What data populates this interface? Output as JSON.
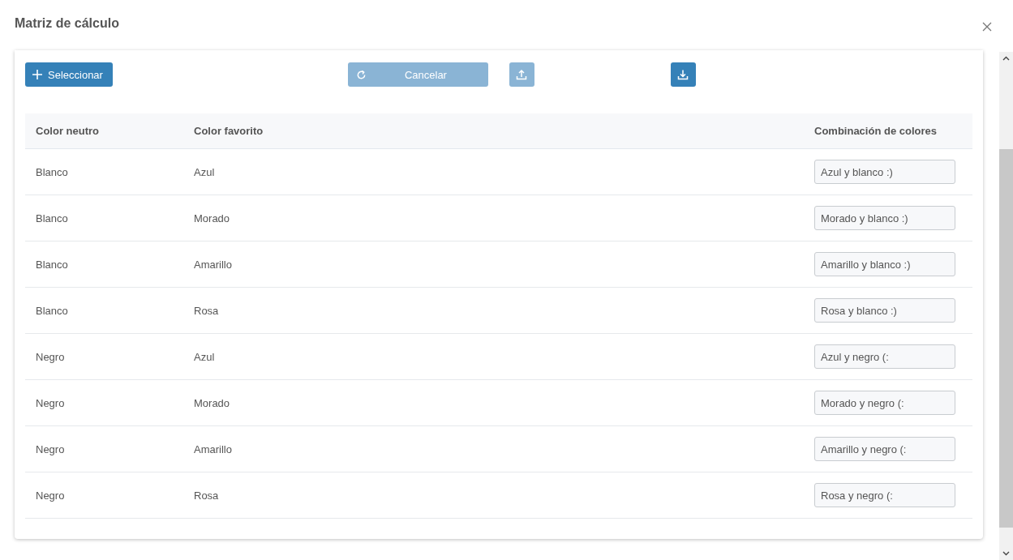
{
  "dialog": {
    "title": "Matriz de cálculo"
  },
  "toolbar": [
    {
      "kind": "add",
      "label": "Seleccionar",
      "disabled": false
    },
    {
      "kind": "reset",
      "label": "Cancelar",
      "disabled": true
    },
    {
      "kind": "upload",
      "disabled": true
    },
    {
      "kind": "download",
      "disabled": false
    }
  ],
  "table": {
    "columns": [
      "Color neutro",
      "Color favorito",
      "Combinación de colores"
    ],
    "rows": [
      {
        "neutral": "Blanco",
        "favorite": "Azul",
        "combination": "Azul y blanco :)"
      },
      {
        "neutral": "Blanco",
        "favorite": "Morado",
        "combination": "Morado y blanco :)"
      },
      {
        "neutral": "Blanco",
        "favorite": "Amarillo",
        "combination": "Amarillo y blanco :)"
      },
      {
        "neutral": "Blanco",
        "favorite": "Rosa",
        "combination": "Rosa y blanco :)"
      },
      {
        "neutral": "Negro",
        "favorite": "Azul",
        "combination": "Azul y negro (:"
      },
      {
        "neutral": "Negro",
        "favorite": "Morado",
        "combination": "Morado y negro (:"
      },
      {
        "neutral": "Negro",
        "favorite": "Amarillo",
        "combination": "Amarillo y negro (:"
      },
      {
        "neutral": "Negro",
        "favorite": "Rosa",
        "combination": "Rosa y negro (:"
      }
    ]
  }
}
